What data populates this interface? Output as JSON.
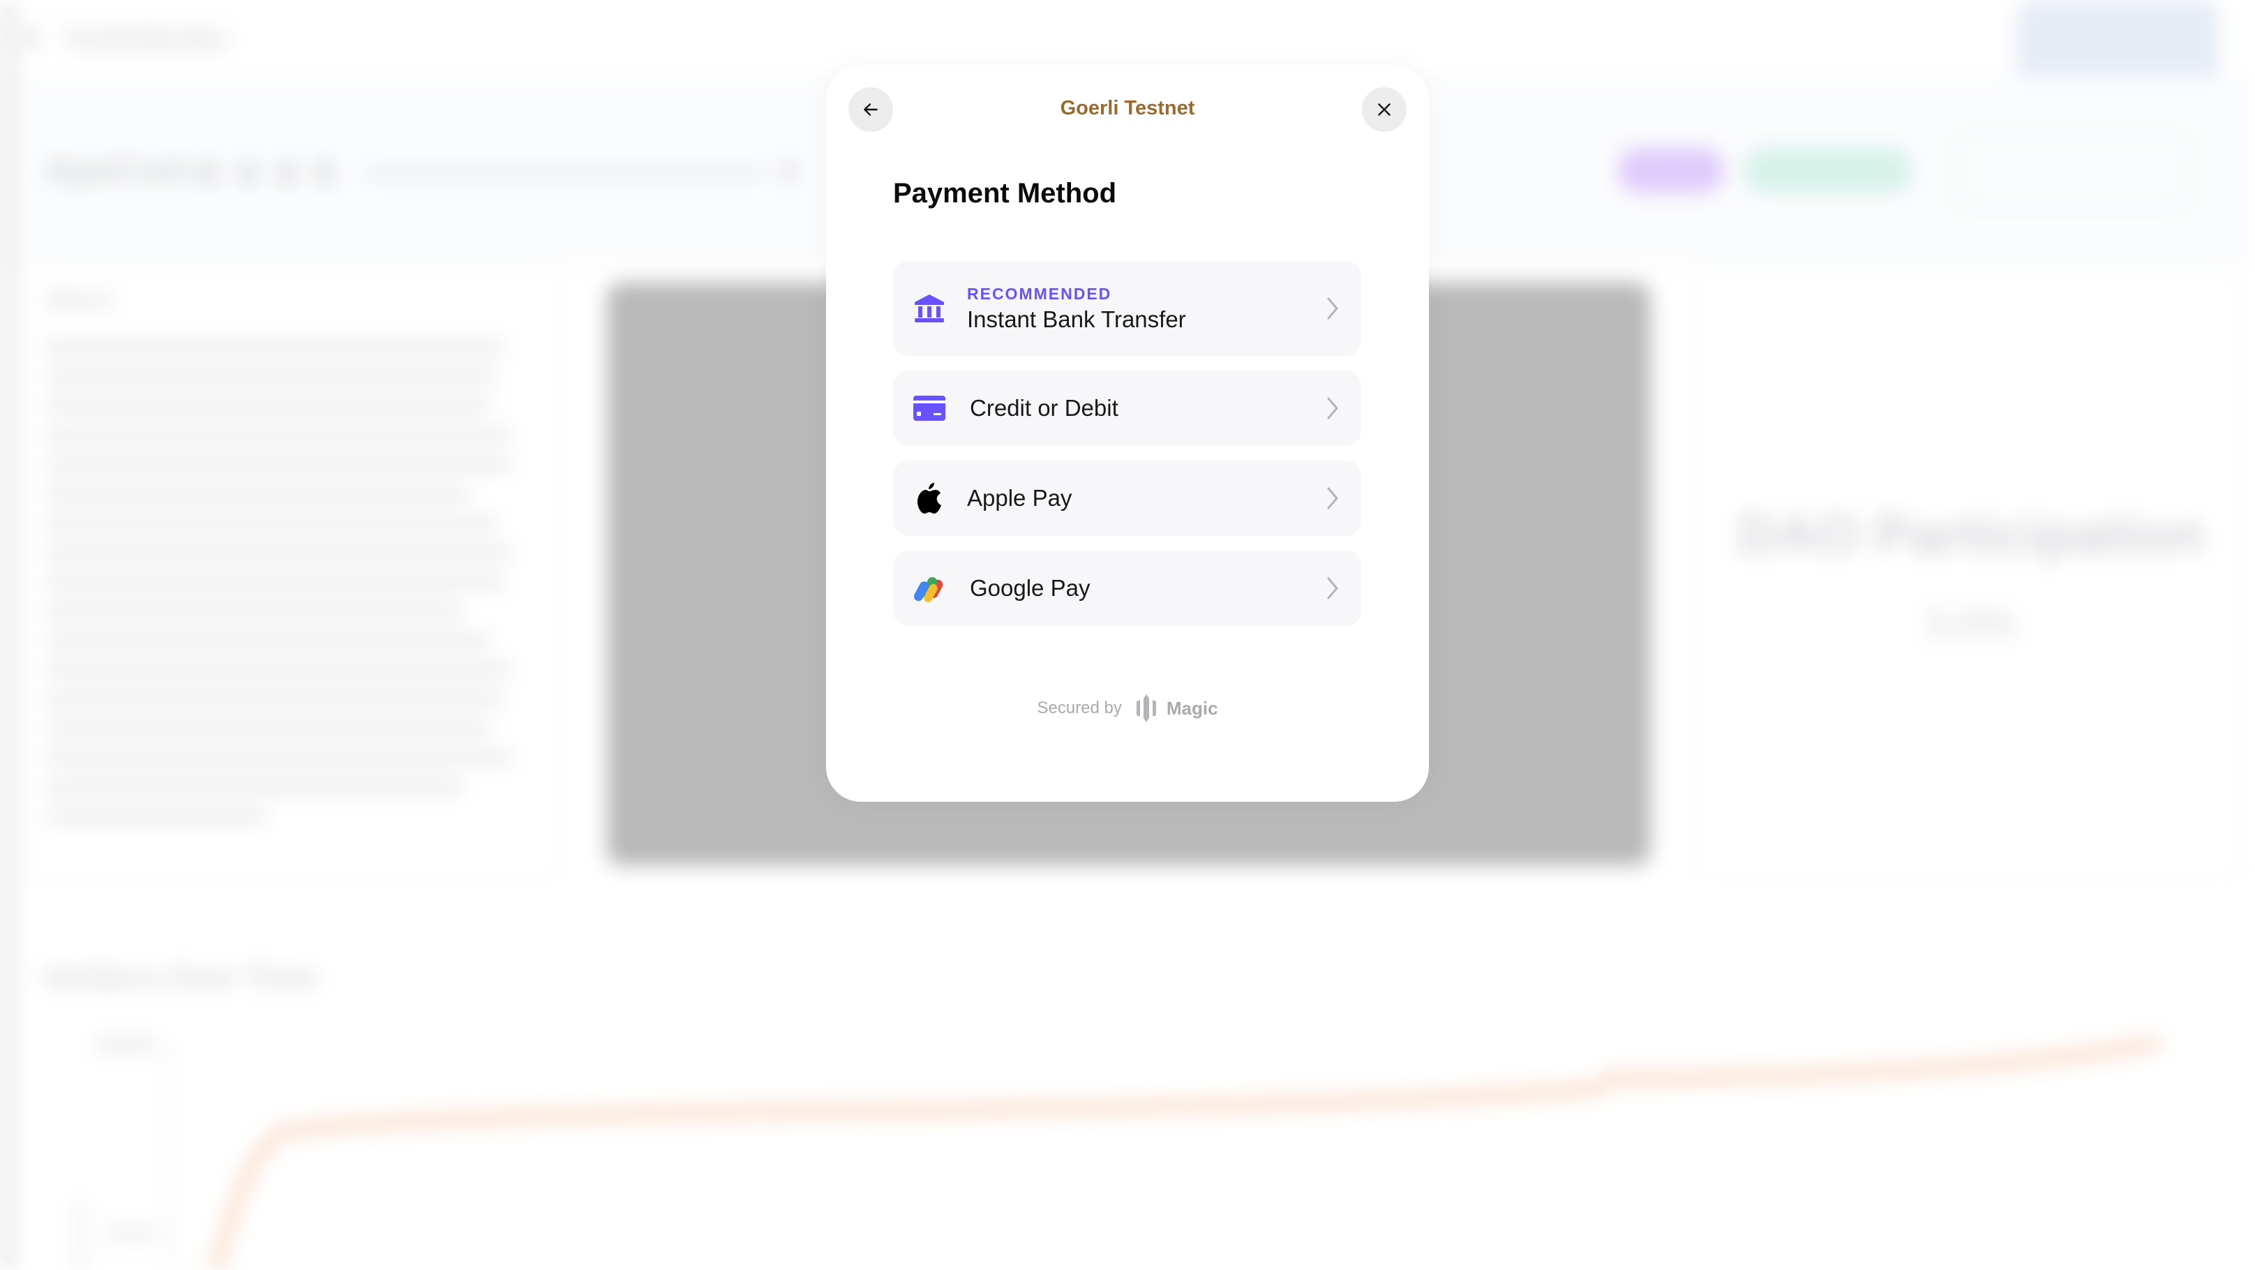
{
  "background": {
    "app_logo_text": "CoinGecko",
    "token_name": "ApeCoin",
    "about_title": "About",
    "dao_card": {
      "title": "DAO Participation",
      "value": "3.0%"
    },
    "chart_title": "Holders Over Time",
    "colors": {
      "image_placeholder": "#b3b3b3",
      "pill_purple": "#dcc7fb",
      "pill_green": "#d3f1e8",
      "chart_line": "#f7c9a8"
    }
  },
  "modal": {
    "network": "Goerli Testnet",
    "title": "Payment Method",
    "back_icon": "arrow-left-icon",
    "close_icon": "close-icon",
    "methods": [
      {
        "badge": "RECOMMENDED",
        "label": "Instant Bank Transfer",
        "icon": "bank-icon"
      },
      {
        "label": "Credit or Debit",
        "icon": "credit-card-icon"
      },
      {
        "label": "Apple Pay",
        "icon": "apple-icon"
      },
      {
        "label": "Google Pay",
        "icon": "google-pay-icon"
      }
    ],
    "footer": {
      "secured_by": "Secured by",
      "brand": "Magic"
    },
    "colors": {
      "network_title": "#9a6b2f",
      "accent": "#6851ff",
      "row_background": "#f7f7f9",
      "chevron": "#b4b4b8"
    }
  }
}
